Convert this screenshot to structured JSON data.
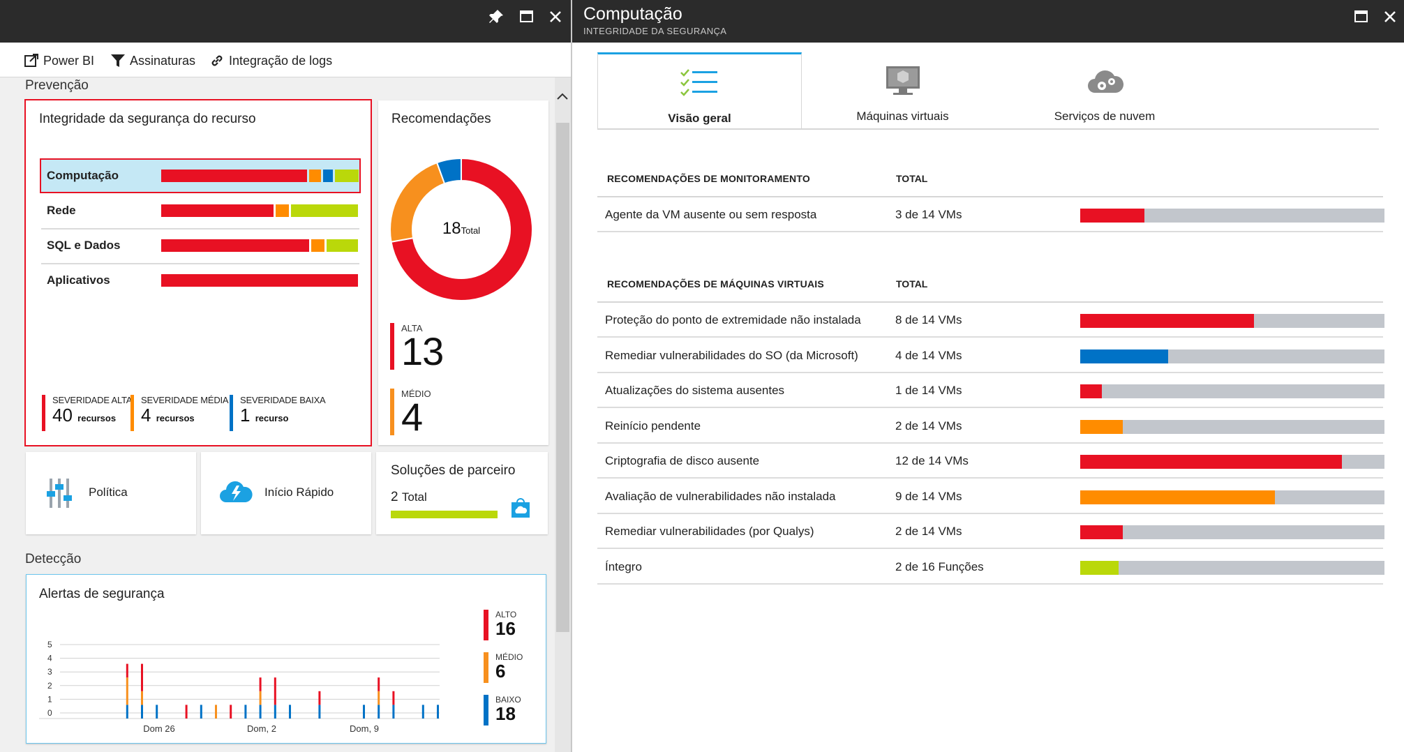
{
  "left_blade": {
    "toolbar": {
      "power_bi": "Power BI",
      "subscriptions": "Assinaturas",
      "log_integration": "Integração de logs"
    },
    "prevention_label": "Prevenção",
    "resource_health": {
      "title": "Integridade da segurança do recurso",
      "rows": [
        {
          "name": "Computação",
          "segments": [
            {
              "color": "#e81123",
              "pct": 74
            },
            {
              "color": "#ff8c00",
              "pct": 6
            },
            {
              "color": "#0072c6",
              "pct": 5
            },
            {
              "color": "#bad80a",
              "pct": 12
            }
          ]
        },
        {
          "name": "Rede",
          "segments": [
            {
              "color": "#e81123",
              "pct": 57
            },
            {
              "color": "#ff8c00",
              "pct": 7
            },
            {
              "color": "#bad80a",
              "pct": 34
            }
          ]
        },
        {
          "name": "SQL e Dados",
          "segments": [
            {
              "color": "#e81123",
              "pct": 75
            },
            {
              "color": "#ff8c00",
              "pct": 7
            },
            {
              "color": "#bad80a",
              "pct": 16
            }
          ]
        },
        {
          "name": "Aplicativos",
          "segments": [
            {
              "color": "#e81123",
              "pct": 100
            }
          ]
        }
      ],
      "severity": {
        "high": {
          "label": "SEVERIDADE ALTA",
          "count": "40",
          "unit": "recursos"
        },
        "medium": {
          "label": "SEVERIDADE MÉDIA",
          "count": "4",
          "unit": "recursos"
        },
        "low": {
          "label": "SEVERIDADE BAIXA",
          "count": "1",
          "unit": "recurso"
        }
      }
    },
    "recommendations": {
      "title": "Recomendações",
      "total_number": "18",
      "total_word": "Total",
      "high_label": "ALTA",
      "high_count": "13",
      "medium_label": "MÉDIO",
      "medium_count": "4"
    },
    "policy_label": "Política",
    "quickstart_label": "Início Rápido",
    "partners": {
      "title": "Soluções de parceiro",
      "count": "2",
      "word": "Total"
    },
    "detection_label": "Detecção",
    "alerts": {
      "title": "Alertas de segurança",
      "high_label": "ALTO",
      "high_count": "16",
      "medium_label": "MÉDIO",
      "medium_count": "6",
      "low_label": "BAIXO",
      "low_count": "18"
    }
  },
  "right_blade": {
    "title": "Computação",
    "subtitle": "INTEGRIDADE DA SEGURANÇA",
    "tabs": [
      "Visão geral",
      "Máquinas virtuais",
      "Serviços de nuvem"
    ],
    "monitoring": {
      "header": "RECOMENDAÇÕES DE MONITORAMENTO",
      "total_header": "TOTAL",
      "rows": [
        {
          "name": "Agente da VM ausente ou sem resposta",
          "total": "3 de 14 VMs",
          "pct": 21,
          "color": "#e81123"
        }
      ]
    },
    "vm_recs": {
      "header": "RECOMENDAÇÕES DE MÁQUINAS VIRTUAIS",
      "total_header": "TOTAL",
      "rows": [
        {
          "name": "Proteção do ponto de extremidade não instalada",
          "total": "8 de 14 VMs",
          "pct": 57,
          "color": "#e81123"
        },
        {
          "name": "Remediar vulnerabilidades do SO (da Microsoft)",
          "total": "4 de 14 VMs",
          "pct": 29,
          "color": "#0072c6"
        },
        {
          "name": "Atualizações do sistema ausentes",
          "total": "1 de 14 VMs",
          "pct": 7,
          "color": "#e81123"
        },
        {
          "name": "Reinício pendente",
          "total": "2 de 14 VMs",
          "pct": 14,
          "color": "#ff8c00"
        },
        {
          "name": "Criptografia de disco ausente",
          "total": "12 de 14 VMs",
          "pct": 86,
          "color": "#e81123"
        },
        {
          "name": "Avaliação de vulnerabilidades não instalada",
          "total": "9 de 14 VMs",
          "pct": 64,
          "color": "#ff8c00"
        },
        {
          "name": "Remediar vulnerabilidades (por Qualys)",
          "total": "2 de 14 VMs",
          "pct": 14,
          "color": "#e81123"
        },
        {
          "name": "Íntegro",
          "total": "2 de 16 Funções",
          "pct": 12.5,
          "color": "#bad80a"
        }
      ]
    }
  },
  "chart_data": [
    {
      "type": "pie",
      "title": "Recomendações",
      "categories": [
        "Alta",
        "Médio",
        "Baixo"
      ],
      "values": [
        13,
        4,
        1
      ],
      "colors": [
        "#e81123",
        "#f7901e",
        "#0072c6"
      ]
    },
    {
      "type": "bar",
      "title": "Alertas de segurança",
      "stacked": true,
      "yticks": [
        0,
        1,
        2,
        3,
        4,
        5
      ],
      "xticks": [
        "Dom 26",
        "Dom, 2",
        "Dom, 9"
      ],
      "ylim": [
        0,
        5
      ],
      "grid": true,
      "series": [
        {
          "name": "ALTO",
          "color": "#e81123",
          "values": [
            0,
            0,
            0,
            0,
            1,
            2,
            0,
            0,
            1,
            0,
            0,
            1,
            0,
            1,
            2,
            0,
            0,
            1,
            0,
            0,
            0,
            1,
            1,
            0,
            0,
            0,
            1
          ]
        },
        {
          "name": "MÉDIO",
          "color": "#f7901e",
          "values": [
            0,
            0,
            0,
            0,
            2,
            1,
            0,
            0,
            0,
            0,
            1,
            0,
            0,
            1,
            0,
            0,
            0,
            0,
            0,
            0,
            0,
            1,
            0,
            0,
            0,
            0,
            0
          ]
        },
        {
          "name": "BAIXO",
          "color": "#0072c6",
          "values": [
            0,
            0,
            0,
            0,
            1,
            1,
            1,
            0,
            0,
            1,
            0,
            0,
            1,
            1,
            1,
            1,
            0,
            1,
            0,
            0,
            1,
            1,
            1,
            0,
            1,
            1,
            0
          ]
        }
      ]
    }
  ]
}
